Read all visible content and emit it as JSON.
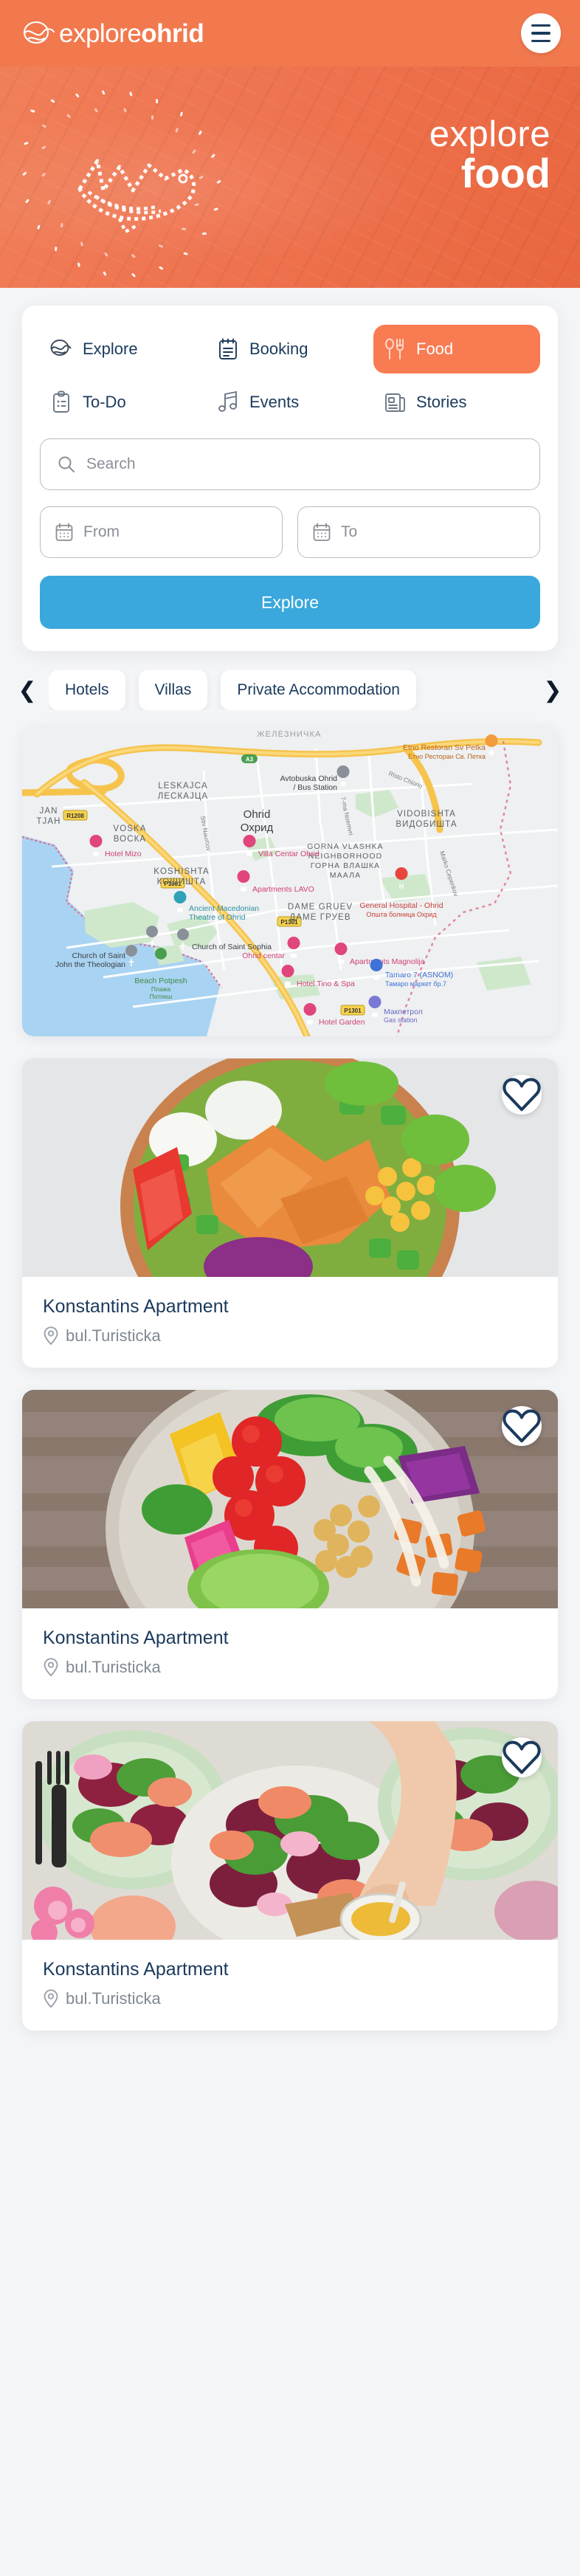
{
  "header": {
    "logo_thin": "explore",
    "logo_bold": "ohrid",
    "logo_mark_icon": "wave-fish-logo-icon",
    "menu_icon": "hamburger-menu-icon"
  },
  "hero": {
    "title_line1": "explore",
    "title_line2": "food",
    "art_icon": "dotted-fish-illustration"
  },
  "nav": {
    "items": [
      {
        "label": "Explore",
        "icon": "compass-wave-icon",
        "active": false
      },
      {
        "label": "Booking",
        "icon": "calendar-list-icon",
        "active": false
      },
      {
        "label": "Food",
        "icon": "spoon-fork-icon",
        "active": true
      },
      {
        "label": "To-Do",
        "icon": "clipboard-check-icon",
        "active": false
      },
      {
        "label": "Events",
        "icon": "music-note-icon",
        "active": false
      },
      {
        "label": "Stories",
        "icon": "newspaper-icon",
        "active": false
      }
    ]
  },
  "search_form": {
    "search_placeholder": "Search",
    "search_value": "",
    "search_icon": "search-icon",
    "from_placeholder": "From",
    "from_value": "",
    "to_placeholder": "To",
    "to_value": "",
    "calendar_icon": "calendar-icon",
    "submit_label": "Explore"
  },
  "filters": {
    "prev_icon": "chevron-left-icon",
    "next_icon": "chevron-right-icon",
    "chips": [
      {
        "label": "Hotels"
      },
      {
        "label": "Villas"
      },
      {
        "label": "Private Accommodation"
      }
    ]
  },
  "map": {
    "city_label_en": "Ohrid",
    "city_label_mk": "Охрид",
    "area_labels": [
      {
        "en": "LESKAJCA",
        "mk": "ЛЕСКАЈЦА"
      },
      {
        "en": "VOSKA",
        "mk": "ВОСКА"
      },
      {
        "en": "KOSHISHTA",
        "mk": "КОШИШТА"
      },
      {
        "en": "VIDOBISHTA",
        "mk": "ВИДОБИШТА"
      },
      {
        "en": "DAME GRUEV",
        "mk": "ДАМЕ ГРУЕВ"
      },
      {
        "en": "GORNA VLASHKA NEIGHBORHOOD",
        "mk": "ГОРНА ВЛАШКА МААЛА"
      },
      {
        "en": "JAN",
        "mk": "TJAH"
      }
    ],
    "road_shields": [
      "R1208",
      "P1301",
      "A3",
      "P1301",
      "P1301"
    ],
    "street_labels": [
      "Stiv Naumov",
      "7-ma Noemvri",
      "Risto Chiorio",
      "Marko Cepenkov"
    ],
    "pois": [
      {
        "name": "Etno Restoran Sv Petka",
        "sub": "Етно Ресторан Св. Петка",
        "type": "restaurant"
      },
      {
        "name": "Avtobuska Ohrid / Bus Station",
        "sub": "",
        "type": "bus"
      },
      {
        "name": "Hotel Mizo",
        "sub": "",
        "type": "hotel"
      },
      {
        "name": "Villa Centar Ohrid",
        "sub": "",
        "type": "hotel"
      },
      {
        "name": "Apartments LAVO",
        "sub": "",
        "type": "hotel"
      },
      {
        "name": "General Hospital - Ohrid",
        "sub": "Општа болница Охрид",
        "type": "hospital"
      },
      {
        "name": "Ancient Macedonian Theatre of Ohrid",
        "sub": "",
        "type": "attraction"
      },
      {
        "name": "Church of Saint Sophia",
        "sub": "",
        "type": "church"
      },
      {
        "name": "Church of Saint John the Theologian",
        "sub": "",
        "type": "church"
      },
      {
        "name": "Beach Potpesh",
        "sub": "Плажа Потпеш",
        "type": "beach"
      },
      {
        "name": "Ohrid centar",
        "sub": "",
        "type": "hotel"
      },
      {
        "name": "Apartments Magnolija",
        "sub": "",
        "type": "hotel"
      },
      {
        "name": "Tamaro 7 (ASNOM)",
        "sub": "Тамаро маркет бр.7",
        "type": "store"
      },
      {
        "name": "Hotel Tino & Spa",
        "sub": "",
        "type": "hotel"
      },
      {
        "name": "Макпетрол",
        "sub": "Gas station",
        "type": "gas"
      },
      {
        "name": "Hotel Garden",
        "sub": "",
        "type": "hotel"
      }
    ]
  },
  "listings": [
    {
      "title": "Konstantins Apartment",
      "location": "bul.Turisticka",
      "location_icon": "map-pin-icon",
      "favorite_icon": "heart-outline-icon",
      "image_alt": "salad-bowl-with-salmon-corn-and-eggs"
    },
    {
      "title": "Konstantins Apartment",
      "location": "bul.Turisticka",
      "location_icon": "map-pin-icon",
      "favorite_icon": "heart-outline-icon",
      "image_alt": "buddha-bowl-with-avocado-chickpeas-and-tomatoes"
    },
    {
      "title": "Konstantins Apartment",
      "location": "bul.Turisticka",
      "location_icon": "map-pin-icon",
      "favorite_icon": "heart-outline-icon",
      "image_alt": "table-spread-of-salad-plates-and-honey"
    }
  ],
  "colors": {
    "brand_orange": "#f2794e",
    "active_tab_orange": "#f97b52",
    "accent_blue": "#3aa8dc",
    "navy_text": "#1b3a5c",
    "page_bg": "#f4f5f7"
  }
}
